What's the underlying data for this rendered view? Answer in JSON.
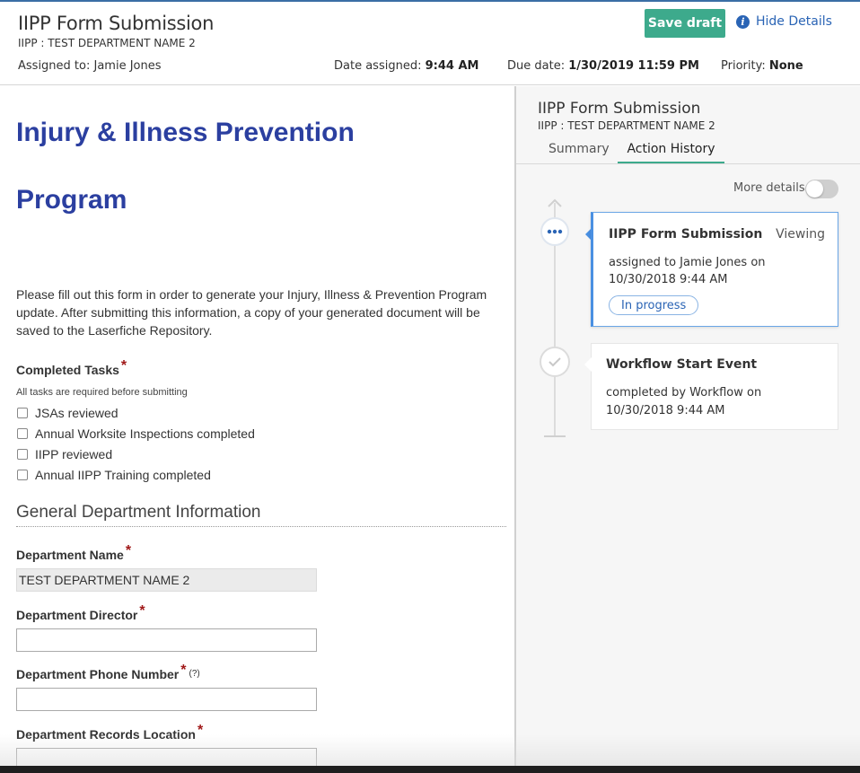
{
  "header": {
    "title": "IIPP Form Submission",
    "subtitle": "IIPP : TEST DEPARTMENT NAME 2",
    "assigned_label": "Assigned to:",
    "assigned_value": "Jamie Jones",
    "date_assigned_label": "Date assigned:",
    "date_assigned_value": "9:44 AM",
    "due_label": "Due date:",
    "due_value": "1/30/2019 11:59 PM",
    "priority_label": "Priority:",
    "priority_value": "None",
    "save_label": "Save draft",
    "hide_details_label": "Hide Details",
    "info_icon_glyph": "i"
  },
  "form": {
    "title_line1": "Injury & Illness Prevention",
    "title_line2": "Program",
    "intro": "Please fill out this form in order to generate your Injury, Illness & Prevention Program update. After submitting this information, a copy of your generated document will be saved to the Laserfiche Repository.",
    "completed_tasks_label": "Completed Tasks",
    "required_mark": "*",
    "completed_tasks_hint": "All tasks are required before submitting",
    "tasks": [
      {
        "label": "JSAs reviewed",
        "checked": false
      },
      {
        "label": "Annual Worksite Inspections completed",
        "checked": false
      },
      {
        "label": "IIPP reviewed",
        "checked": false
      },
      {
        "label": "Annual IIPP Training completed",
        "checked": false
      }
    ],
    "section_title": "General Department Information",
    "dept_name_label": "Department Name",
    "dept_name_value": "TEST DEPARTMENT NAME 2",
    "dept_director_label": "Department Director",
    "dept_director_value": "",
    "dept_phone_label": "Department Phone Number",
    "dept_phone_help": "(?)",
    "dept_phone_value": "",
    "dept_records_label": "Department Records Location",
    "dept_records_value": ""
  },
  "details": {
    "title": "IIPP Form Submission",
    "subtitle": "IIPP : TEST DEPARTMENT NAME 2",
    "tabs": [
      {
        "label": "Summary",
        "active": false
      },
      {
        "label": "Action History",
        "active": true
      }
    ],
    "more_details_label": "More details",
    "more_details_on": false,
    "history": [
      {
        "title": "IIPP Form Submission",
        "status_note": "Viewing",
        "body": "assigned to Jamie Jones on 10/30/2018 9:44 AM",
        "badge": "In progress",
        "node_icon": "ellipsis-icon"
      },
      {
        "title": "Workflow Start Event",
        "body": "completed by Workflow on 10/30/2018 9:44 AM",
        "node_icon": "check-icon"
      }
    ]
  },
  "colors": {
    "accent_green": "#3daa8c",
    "link_blue": "#2a64b5",
    "form_title_blue": "#2b3fa0",
    "required_red": "#a01818"
  }
}
